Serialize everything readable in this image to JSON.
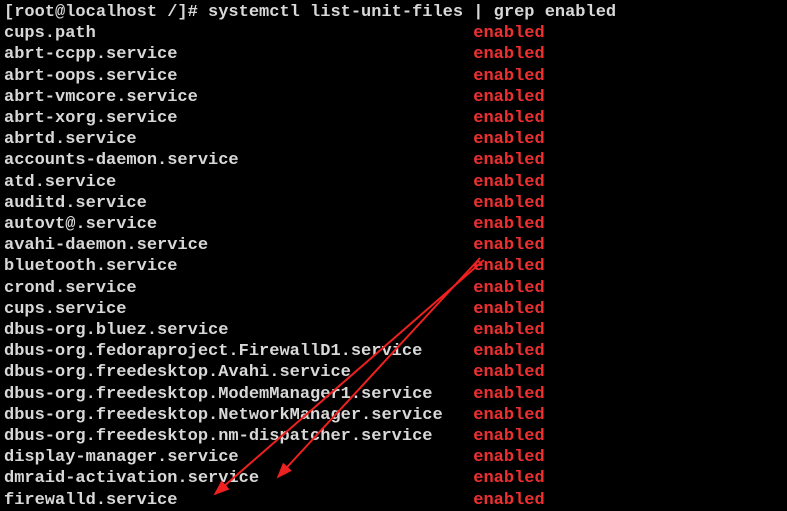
{
  "prompt": "[root@localhost /]# systemctl list-unit-files | grep enabled",
  "unit_col_width": 46,
  "units": [
    {
      "name": "cups.path",
      "state": "enabled"
    },
    {
      "name": "abrt-ccpp.service",
      "state": "enabled"
    },
    {
      "name": "abrt-oops.service",
      "state": "enabled"
    },
    {
      "name": "abrt-vmcore.service",
      "state": "enabled"
    },
    {
      "name": "abrt-xorg.service",
      "state": "enabled"
    },
    {
      "name": "abrtd.service",
      "state": "enabled"
    },
    {
      "name": "accounts-daemon.service",
      "state": "enabled"
    },
    {
      "name": "atd.service",
      "state": "enabled"
    },
    {
      "name": "auditd.service",
      "state": "enabled"
    },
    {
      "name": "autovt@.service",
      "state": "enabled"
    },
    {
      "name": "avahi-daemon.service",
      "state": "enabled"
    },
    {
      "name": "bluetooth.service",
      "state": "enabled"
    },
    {
      "name": "crond.service",
      "state": "enabled"
    },
    {
      "name": "cups.service",
      "state": "enabled"
    },
    {
      "name": "dbus-org.bluez.service",
      "state": "enabled"
    },
    {
      "name": "dbus-org.fedoraproject.FirewallD1.service",
      "state": "enabled"
    },
    {
      "name": "dbus-org.freedesktop.Avahi.service",
      "state": "enabled"
    },
    {
      "name": "dbus-org.freedesktop.ModemManager1.service",
      "state": "enabled"
    },
    {
      "name": "dbus-org.freedesktop.NetworkManager.service",
      "state": "enabled"
    },
    {
      "name": "dbus-org.freedesktop.nm-dispatcher.service",
      "state": "enabled"
    },
    {
      "name": "display-manager.service",
      "state": "enabled"
    },
    {
      "name": "dmraid-activation.service",
      "state": "enabled"
    },
    {
      "name": "firewalld.service",
      "state": "enabled"
    }
  ],
  "arrows": [
    {
      "from": [
        484,
        260
      ],
      "to": [
        215,
        494
      ]
    },
    {
      "from": [
        480,
        258
      ],
      "to": [
        278,
        477
      ]
    }
  ]
}
